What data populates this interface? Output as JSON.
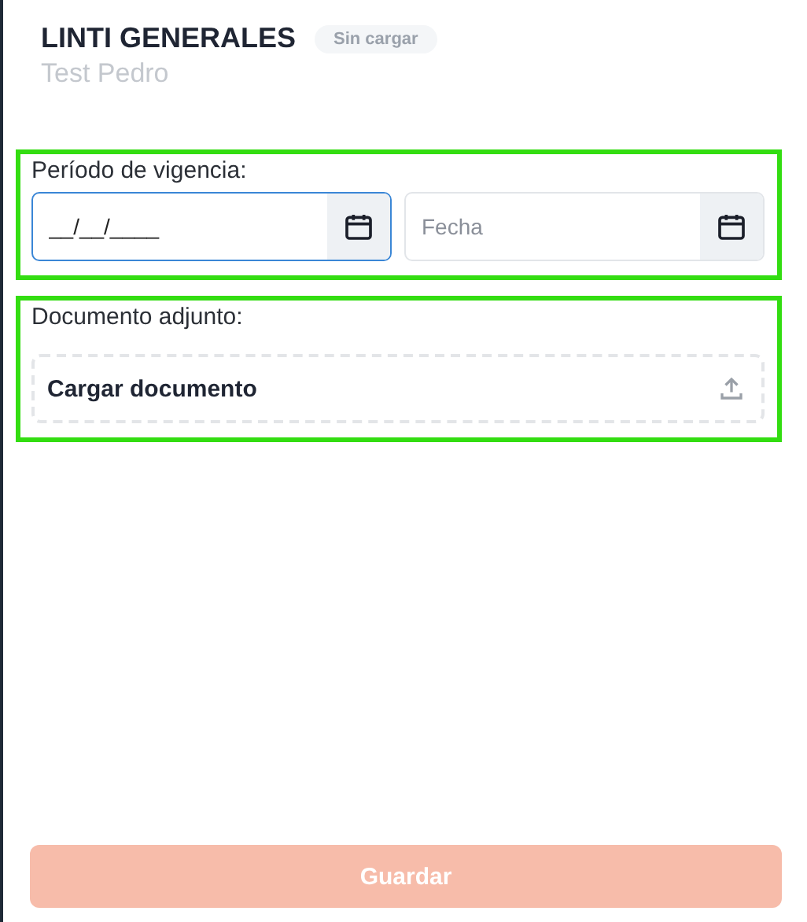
{
  "header": {
    "title": "LINTI GENERALES",
    "status_badge": "Sin cargar",
    "subtitle": "Test Pedro"
  },
  "sections": [
    {
      "kind": "date_range",
      "label": "Período de vigencia:",
      "fields": [
        {
          "value": "__/__/____",
          "focused": true
        },
        {
          "placeholder": "Fecha",
          "focused": false
        }
      ]
    },
    {
      "kind": "upload",
      "label": "Documento adjunto:",
      "button": "Cargar documento"
    }
  ],
  "save_button": {
    "label": "Guardar",
    "disabled": true
  }
}
